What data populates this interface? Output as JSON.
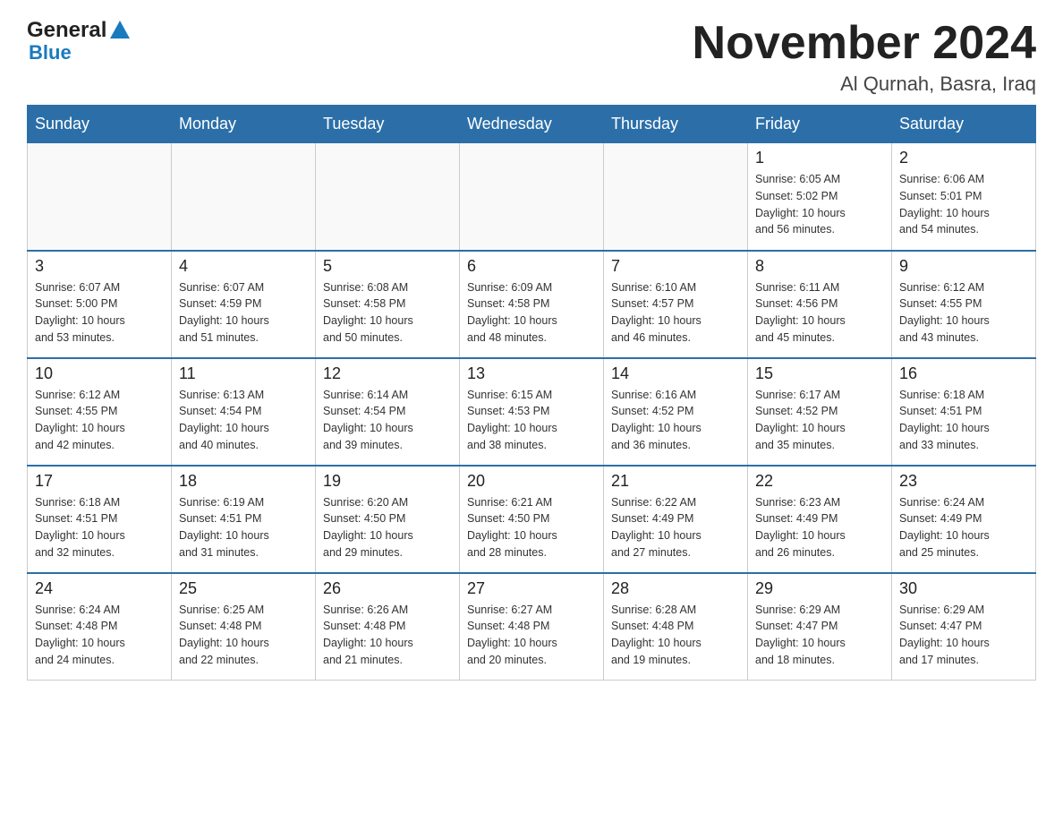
{
  "header": {
    "logo_line1": "General",
    "logo_line2": "Blue",
    "month_title": "November 2024",
    "location": "Al Qurnah, Basra, Iraq"
  },
  "weekdays": [
    "Sunday",
    "Monday",
    "Tuesday",
    "Wednesday",
    "Thursday",
    "Friday",
    "Saturday"
  ],
  "weeks": [
    [
      {
        "day": "",
        "info": ""
      },
      {
        "day": "",
        "info": ""
      },
      {
        "day": "",
        "info": ""
      },
      {
        "day": "",
        "info": ""
      },
      {
        "day": "",
        "info": ""
      },
      {
        "day": "1",
        "info": "Sunrise: 6:05 AM\nSunset: 5:02 PM\nDaylight: 10 hours\nand 56 minutes."
      },
      {
        "day": "2",
        "info": "Sunrise: 6:06 AM\nSunset: 5:01 PM\nDaylight: 10 hours\nand 54 minutes."
      }
    ],
    [
      {
        "day": "3",
        "info": "Sunrise: 6:07 AM\nSunset: 5:00 PM\nDaylight: 10 hours\nand 53 minutes."
      },
      {
        "day": "4",
        "info": "Sunrise: 6:07 AM\nSunset: 4:59 PM\nDaylight: 10 hours\nand 51 minutes."
      },
      {
        "day": "5",
        "info": "Sunrise: 6:08 AM\nSunset: 4:58 PM\nDaylight: 10 hours\nand 50 minutes."
      },
      {
        "day": "6",
        "info": "Sunrise: 6:09 AM\nSunset: 4:58 PM\nDaylight: 10 hours\nand 48 minutes."
      },
      {
        "day": "7",
        "info": "Sunrise: 6:10 AM\nSunset: 4:57 PM\nDaylight: 10 hours\nand 46 minutes."
      },
      {
        "day": "8",
        "info": "Sunrise: 6:11 AM\nSunset: 4:56 PM\nDaylight: 10 hours\nand 45 minutes."
      },
      {
        "day": "9",
        "info": "Sunrise: 6:12 AM\nSunset: 4:55 PM\nDaylight: 10 hours\nand 43 minutes."
      }
    ],
    [
      {
        "day": "10",
        "info": "Sunrise: 6:12 AM\nSunset: 4:55 PM\nDaylight: 10 hours\nand 42 minutes."
      },
      {
        "day": "11",
        "info": "Sunrise: 6:13 AM\nSunset: 4:54 PM\nDaylight: 10 hours\nand 40 minutes."
      },
      {
        "day": "12",
        "info": "Sunrise: 6:14 AM\nSunset: 4:54 PM\nDaylight: 10 hours\nand 39 minutes."
      },
      {
        "day": "13",
        "info": "Sunrise: 6:15 AM\nSunset: 4:53 PM\nDaylight: 10 hours\nand 38 minutes."
      },
      {
        "day": "14",
        "info": "Sunrise: 6:16 AM\nSunset: 4:52 PM\nDaylight: 10 hours\nand 36 minutes."
      },
      {
        "day": "15",
        "info": "Sunrise: 6:17 AM\nSunset: 4:52 PM\nDaylight: 10 hours\nand 35 minutes."
      },
      {
        "day": "16",
        "info": "Sunrise: 6:18 AM\nSunset: 4:51 PM\nDaylight: 10 hours\nand 33 minutes."
      }
    ],
    [
      {
        "day": "17",
        "info": "Sunrise: 6:18 AM\nSunset: 4:51 PM\nDaylight: 10 hours\nand 32 minutes."
      },
      {
        "day": "18",
        "info": "Sunrise: 6:19 AM\nSunset: 4:51 PM\nDaylight: 10 hours\nand 31 minutes."
      },
      {
        "day": "19",
        "info": "Sunrise: 6:20 AM\nSunset: 4:50 PM\nDaylight: 10 hours\nand 29 minutes."
      },
      {
        "day": "20",
        "info": "Sunrise: 6:21 AM\nSunset: 4:50 PM\nDaylight: 10 hours\nand 28 minutes."
      },
      {
        "day": "21",
        "info": "Sunrise: 6:22 AM\nSunset: 4:49 PM\nDaylight: 10 hours\nand 27 minutes."
      },
      {
        "day": "22",
        "info": "Sunrise: 6:23 AM\nSunset: 4:49 PM\nDaylight: 10 hours\nand 26 minutes."
      },
      {
        "day": "23",
        "info": "Sunrise: 6:24 AM\nSunset: 4:49 PM\nDaylight: 10 hours\nand 25 minutes."
      }
    ],
    [
      {
        "day": "24",
        "info": "Sunrise: 6:24 AM\nSunset: 4:48 PM\nDaylight: 10 hours\nand 24 minutes."
      },
      {
        "day": "25",
        "info": "Sunrise: 6:25 AM\nSunset: 4:48 PM\nDaylight: 10 hours\nand 22 minutes."
      },
      {
        "day": "26",
        "info": "Sunrise: 6:26 AM\nSunset: 4:48 PM\nDaylight: 10 hours\nand 21 minutes."
      },
      {
        "day": "27",
        "info": "Sunrise: 6:27 AM\nSunset: 4:48 PM\nDaylight: 10 hours\nand 20 minutes."
      },
      {
        "day": "28",
        "info": "Sunrise: 6:28 AM\nSunset: 4:48 PM\nDaylight: 10 hours\nand 19 minutes."
      },
      {
        "day": "29",
        "info": "Sunrise: 6:29 AM\nSunset: 4:47 PM\nDaylight: 10 hours\nand 18 minutes."
      },
      {
        "day": "30",
        "info": "Sunrise: 6:29 AM\nSunset: 4:47 PM\nDaylight: 10 hours\nand 17 minutes."
      }
    ]
  ]
}
